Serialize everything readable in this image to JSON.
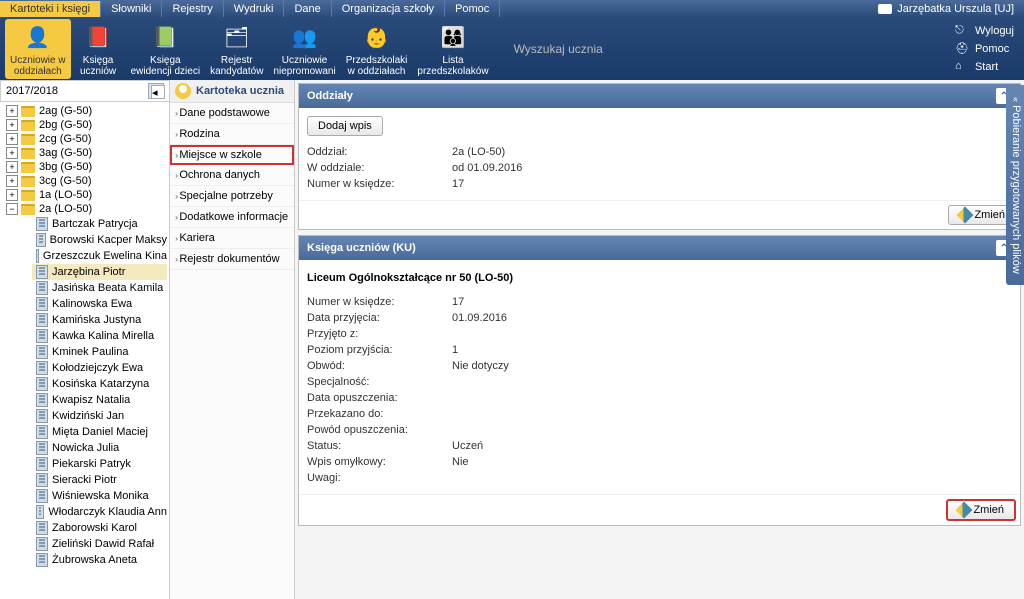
{
  "menubar": {
    "items": [
      "Kartoteki i księgi",
      "Słowniki",
      "Rejestry",
      "Wydruki",
      "Dane",
      "Organizacja szkoły",
      "Pomoc"
    ],
    "user": "Jarzębatka Urszula [UJ]"
  },
  "toolbar": {
    "items": [
      {
        "line1": "Uczniowie w",
        "line2": "oddziałach",
        "active": true,
        "icon": "👤"
      },
      {
        "line1": "Księga",
        "line2": "uczniów",
        "icon": "📕"
      },
      {
        "line1": "Księga",
        "line2": "ewidencji dzieci",
        "icon": "📗"
      },
      {
        "line1": "Rejestr",
        "line2": "kandydatów",
        "icon": "🗂"
      },
      {
        "line1": "Uczniowie",
        "line2": "niepromowani",
        "icon": "👥"
      },
      {
        "line1": "Przedszkolaki",
        "line2": "w oddziałach",
        "icon": "👶"
      },
      {
        "line1": "Lista",
        "line2": "przedszkolaków",
        "icon": "👨‍👩‍👦"
      }
    ],
    "search_placeholder": "Wyszukaj ucznia"
  },
  "right_menu": {
    "logout": "Wyloguj",
    "help": "Pomoc",
    "start": "Start"
  },
  "year": "2017/2018",
  "tree": {
    "classes": [
      "2ag (G-50)",
      "2bg (G-50)",
      "2cg (G-50)",
      "3ag (G-50)",
      "3bg (G-50)",
      "3cg (G-50)",
      "1a (LO-50)",
      "2a (LO-50)"
    ],
    "expanded_class": "2a (LO-50)",
    "students": [
      "Bartczak Patrycja",
      "Borowski Kacper Maksy",
      "Grzeszczuk Ewelina Kina",
      "Jarzębina Piotr",
      "Jasińska Beata Kamila",
      "Kalinowska Ewa",
      "Kamińska Justyna",
      "Kawka Kalina Mirella",
      "Kminek Paulina",
      "Kołodziejczyk Ewa",
      "Kosińska Katarzyna",
      "Kwapisz Natalia",
      "Kwidziński Jan",
      "Mięta Daniel Maciej",
      "Nowicka Julia",
      "Piekarski Patryk",
      "Sieracki Piotr",
      "Wiśniewska Monika",
      "Włodarczyk Klaudia Ann",
      "Zaborowski Karol",
      "Zieliński Dawid Rafał",
      "Żubrowska Aneta"
    ],
    "selected_student": "Jarzębina Piotr"
  },
  "mid_panel": {
    "title": "Kartoteka ucznia",
    "items": [
      "Dane podstawowe",
      "Rodzina",
      "Miejsce w szkole",
      "Ochrona danych",
      "Specjalne potrzeby",
      "Dodatkowe informacje",
      "Kariera",
      "Rejestr dokumentów"
    ],
    "highlighted": "Miejsce w szkole"
  },
  "content": {
    "panel1": {
      "title": "Oddziały",
      "add_btn": "Dodaj wpis",
      "rows": [
        {
          "label": "Oddział:",
          "value": "2a (LO-50)"
        },
        {
          "label": "W oddziale:",
          "value": "od 01.09.2016"
        },
        {
          "label": "Numer w księdze:",
          "value": "17"
        }
      ],
      "change_btn": "Zmień"
    },
    "panel2": {
      "title": "Księga uczniów (KU)",
      "subtitle": "Liceum Ogólnokształcące nr 50 (LO-50)",
      "rows": [
        {
          "label": "Numer w księdze:",
          "value": "17"
        },
        {
          "label": "Data przyjęcia:",
          "value": "01.09.2016"
        },
        {
          "label": "Przyjęto z:",
          "value": ""
        },
        {
          "label": "Poziom przyjścia:",
          "value": "1"
        },
        {
          "label": "Obwód:",
          "value": "Nie dotyczy"
        },
        {
          "label": "Specjalność:",
          "value": ""
        },
        {
          "label": "Data opuszczenia:",
          "value": ""
        },
        {
          "label": "Przekazano do:",
          "value": ""
        },
        {
          "label": "Powód opuszczenia:",
          "value": ""
        },
        {
          "label": "Status:",
          "value": "Uczeń"
        },
        {
          "label": "Wpis omyłkowy:",
          "value": "Nie"
        },
        {
          "label": "Uwagi:",
          "value": ""
        }
      ],
      "change_btn": "Zmień"
    }
  },
  "side_tab": "Pobieranie przygotowanych plików"
}
